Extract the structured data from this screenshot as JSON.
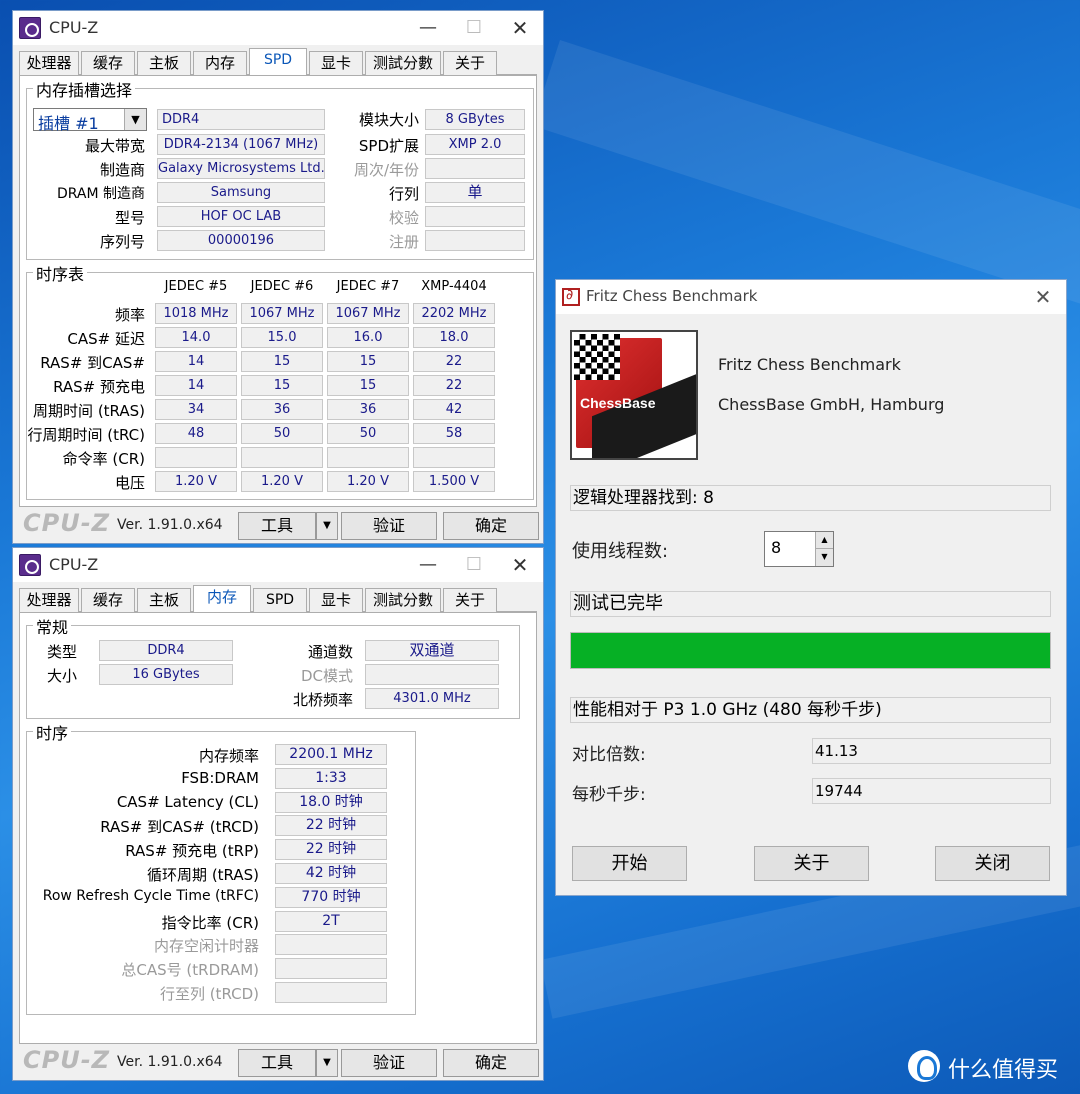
{
  "spd_window": {
    "title": "CPU-Z",
    "tabs": [
      "处理器",
      "缓存",
      "主板",
      "内存",
      "SPD",
      "显卡",
      "测試分數",
      "关于"
    ],
    "active_tab": "SPD",
    "slot_group_title": "内存插槽选择",
    "slot_select": "插槽 #1",
    "module_type": "DDR4",
    "module_size_label": "模块大小",
    "module_size": "8 GBytes",
    "max_bandwidth_label": "最大带宽",
    "max_bandwidth": "DDR4-2134 (1067 MHz)",
    "spd_ext_label": "SPD扩展",
    "spd_ext": "XMP 2.0",
    "manufacturer_label": "制造商",
    "manufacturer": "Galaxy Microsystems Ltd.",
    "week_year_label": "周次/年份",
    "week_year": "",
    "dram_mfr_label": "DRAM 制造商",
    "dram_mfr": "Samsung",
    "ranks_label": "行列",
    "ranks": "单",
    "part_label": "型号",
    "part": "HOF OC LAB",
    "correction_label": "校验",
    "correction": "",
    "serial_label": "序列号",
    "serial": "00000196",
    "registered_label": "注册",
    "registered": "",
    "timings_title": "时序表",
    "columns": [
      "JEDEC #5",
      "JEDEC #6",
      "JEDEC #7",
      "XMP-4404"
    ],
    "rows": [
      {
        "label": "频率",
        "values": [
          "1018 MHz",
          "1067 MHz",
          "1067 MHz",
          "2202 MHz"
        ]
      },
      {
        "label": "CAS# 延迟",
        "values": [
          "14.0",
          "15.0",
          "16.0",
          "18.0"
        ]
      },
      {
        "label": "RAS# 到CAS#",
        "values": [
          "14",
          "15",
          "15",
          "22"
        ]
      },
      {
        "label": "RAS# 预充电",
        "values": [
          "14",
          "15",
          "15",
          "22"
        ]
      },
      {
        "label": "周期时间 (tRAS)",
        "values": [
          "34",
          "36",
          "36",
          "42"
        ]
      },
      {
        "label": "行周期时间 (tRC)",
        "values": [
          "48",
          "50",
          "50",
          "58"
        ]
      },
      {
        "label": "命令率 (CR)",
        "values": [
          "",
          "",
          "",
          ""
        ]
      },
      {
        "label": "电压",
        "values": [
          "1.20 V",
          "1.20 V",
          "1.20 V",
          "1.500 V"
        ]
      }
    ]
  },
  "mem_window": {
    "title": "CPU-Z",
    "tabs": [
      "处理器",
      "缓存",
      "主板",
      "内存",
      "SPD",
      "显卡",
      "测試分數",
      "关于"
    ],
    "active_tab": "内存",
    "general_title": "常规",
    "type_label": "类型",
    "type": "DDR4",
    "channels_label": "通道数",
    "channels": "双通道",
    "size_label": "大小",
    "size": "16 GBytes",
    "dc_mode_label": "DC模式",
    "dc_mode": "",
    "nb_freq_label": "北桥频率",
    "nb_freq": "4301.0 MHz",
    "timings_title": "时序",
    "rows": [
      {
        "label": "内存频率",
        "value": "2200.1 MHz",
        "disabled": false
      },
      {
        "label": "FSB:DRAM",
        "value": "1:33",
        "disabled": false
      },
      {
        "label": "CAS# Latency (CL)",
        "value": "18.0 时钟",
        "disabled": false
      },
      {
        "label": "RAS# 到CAS# (tRCD)",
        "value": "22 时钟",
        "disabled": false
      },
      {
        "label": "RAS# 预充电 (tRP)",
        "value": "22 时钟",
        "disabled": false
      },
      {
        "label": "循环周期 (tRAS)",
        "value": "42 时钟",
        "disabled": false
      },
      {
        "label": "Row Refresh Cycle Time (tRFC)",
        "value": "770 时钟",
        "disabled": false
      },
      {
        "label": "指令比率 (CR)",
        "value": "2T",
        "disabled": false
      },
      {
        "label": "内存空闲计时器",
        "value": "",
        "disabled": true
      },
      {
        "label": "总CAS号 (tRDRAM)",
        "value": "",
        "disabled": true
      },
      {
        "label": "行至列 (tRCD)",
        "value": "",
        "disabled": true
      }
    ]
  },
  "footer": {
    "logo": "CPU-Z",
    "version": "Ver. 1.91.0.x64",
    "tools": "工具",
    "verify": "验证",
    "ok": "确定"
  },
  "fritz": {
    "title": "Fritz Chess Benchmark",
    "logo_text": "ChessBase",
    "app_name": "Fritz Chess Benchmark",
    "company": "ChessBase GmbH, Hamburg",
    "logical_processors": "逻辑处理器找到: 8",
    "threads_label": "使用线程数:",
    "threads_value": "8",
    "status": "测试已完毕",
    "progress": 1.0,
    "relative_perf": "性能相对于 P3 1.0 GHz (480 每秒千步)",
    "ratio_label": "对比倍数:",
    "ratio_value": "41.13",
    "knps_label": "每秒千步:",
    "knps_value": "19744",
    "start": "开始",
    "about": "关于",
    "close": "关闭",
    "progress_color": "#06b025"
  },
  "watermark": "什么值得买"
}
